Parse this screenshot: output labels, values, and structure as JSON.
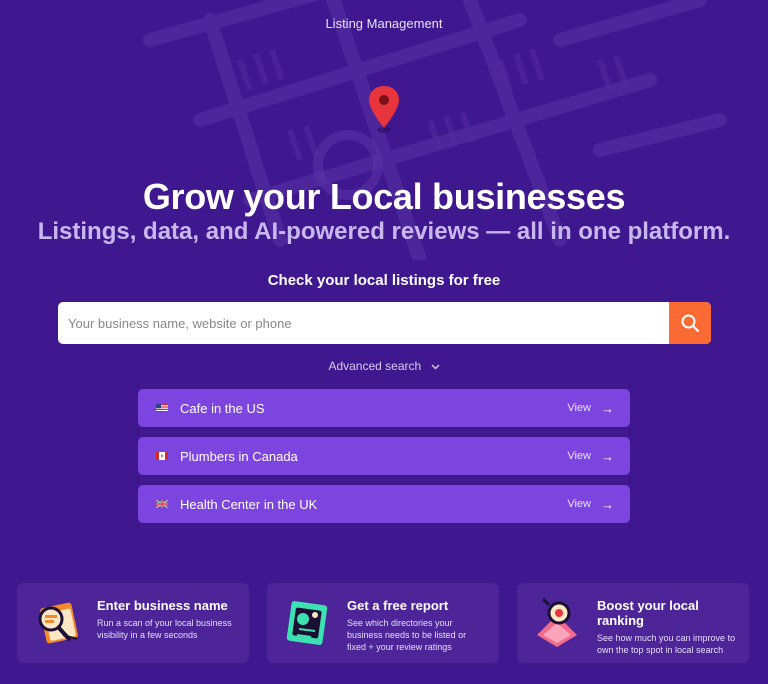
{
  "header": {
    "title": "Listing Management"
  },
  "hero": {
    "title": "Grow your Local businesses",
    "subtitle": "Listings, data, and AI-powered reviews — all in one platform."
  },
  "search": {
    "label": "Check your local listings for free",
    "placeholder": "Your business name, website or phone",
    "value": "",
    "button_icon": "search-icon",
    "advanced_label": "Advanced search"
  },
  "quick_searches": [
    {
      "flag": "us-flag-icon",
      "label": "Cafe in the US",
      "action": "View"
    },
    {
      "flag": "canada-flag-icon",
      "label": "Plumbers in Canada",
      "action": "View"
    },
    {
      "flag": "uk-flag-icon",
      "label": "Health Center in the UK",
      "action": "View"
    }
  ],
  "steps": [
    {
      "icon": "magnifier-document-illustration",
      "title": "Enter business name",
      "text": "Run a scan of your local business visibility in a few seconds"
    },
    {
      "icon": "report-illustration",
      "title": "Get a free report",
      "text": "See which directories your business needs to be listed or fixed + your review ratings"
    },
    {
      "icon": "target-ranking-illustration",
      "title": "Boost your local ranking",
      "text": "See how much you can improve to own the top spot in local search"
    }
  ],
  "colors": {
    "background": "#3f178f",
    "accent": "#fb6a33",
    "quick_button": "#7d45e0",
    "card": "#4d2599"
  }
}
